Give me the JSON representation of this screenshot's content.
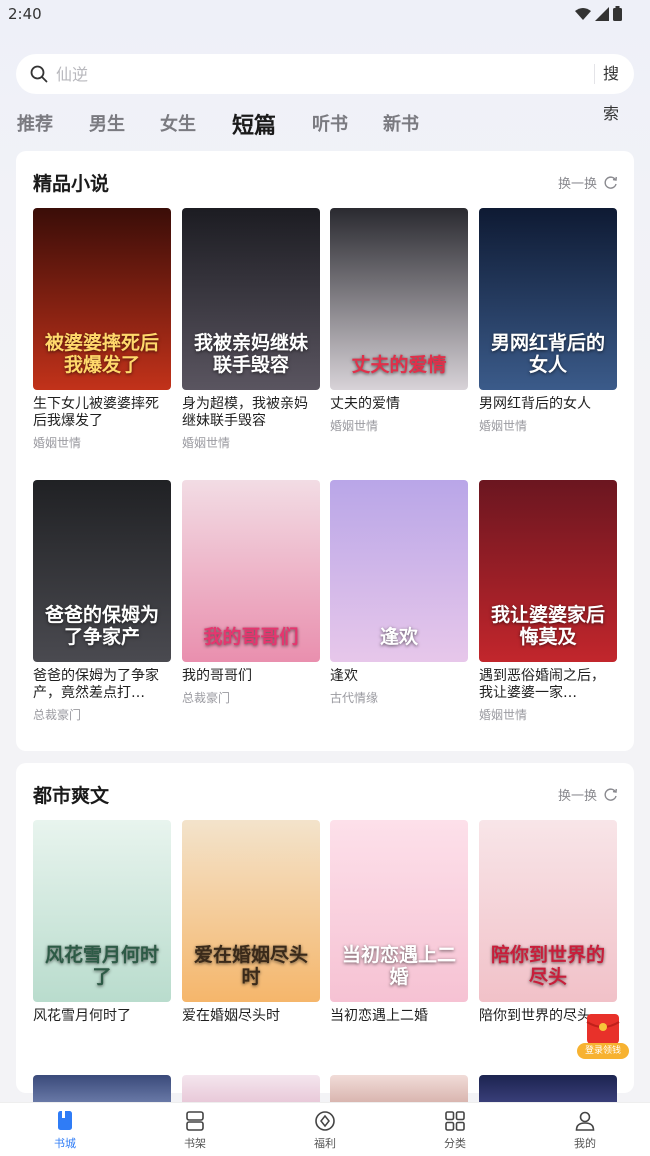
{
  "status_bar": {
    "time": "2:40"
  },
  "search": {
    "placeholder": "仙逆",
    "button_label": "搜索"
  },
  "tabs": [
    {
      "label": "推荐",
      "active": false
    },
    {
      "label": "男生",
      "active": false
    },
    {
      "label": "女生",
      "active": false
    },
    {
      "label": "短篇",
      "active": true
    },
    {
      "label": "听书",
      "active": false
    },
    {
      "label": "新书",
      "active": false
    }
  ],
  "section_premium": {
    "title": "精品小说",
    "refresh_label": "换一换",
    "books": [
      {
        "title": "生下女儿被婆婆摔死后我爆发了",
        "category": "婚姻世情",
        "cover_text": "被婆婆摔死后我爆发了",
        "cover_top": "#3a0d08",
        "cover_bottom": "#c2321a",
        "cover_text_color": "#ffd86b"
      },
      {
        "title": "身为超模，我被亲妈继妹联手毁容",
        "category": "婚姻世情",
        "cover_text": "我被亲妈继妹联手毁容",
        "cover_top": "#1c1c22",
        "cover_bottom": "#5a5560",
        "cover_text_color": "#ffffff"
      },
      {
        "title": "丈夫的爱情",
        "category": "婚姻世情",
        "cover_text": "丈夫的爱情",
        "cover_top": "#2a2a30",
        "cover_bottom": "#d8d3d8",
        "cover_text_color": "#e0304a"
      },
      {
        "title": "男网红背后的女人",
        "category": "婚姻世情",
        "cover_text": "男网红背后的女人",
        "cover_top": "#0e1a33",
        "cover_bottom": "#3b5b8a",
        "cover_text_color": "#ffffff"
      },
      {
        "title": "爸爸的保姆为了争家产，竟然差点打…",
        "category": "总裁豪门",
        "cover_text": "爸爸的保姆为了争家产",
        "cover_top": "#202124",
        "cover_bottom": "#4a4a50",
        "cover_text_color": "#ffffff"
      },
      {
        "title": "我的哥哥们",
        "category": "总裁豪门",
        "cover_text": "我的哥哥们",
        "cover_top": "#f2dce4",
        "cover_bottom": "#e98fae",
        "cover_text_color": "#e5366f"
      },
      {
        "title": "逢欢",
        "category": "古代情缘",
        "cover_text": "逢欢",
        "cover_top": "#b9a6e8",
        "cover_bottom": "#e7c7ea",
        "cover_text_color": "#ffffff"
      },
      {
        "title": "遇到恶俗婚闹之后，我让婆婆一家…",
        "category": "婚姻世情",
        "cover_text": "我让婆婆家后悔莫及",
        "cover_top": "#6b1620",
        "cover_bottom": "#c2262c",
        "cover_text_color": "#ffffff"
      }
    ]
  },
  "section_urban": {
    "title": "都市爽文",
    "refresh_label": "换一换",
    "books": [
      {
        "title": "风花雪月何时了",
        "category": "",
        "cover_text": "风花雪月何时了",
        "cover_top": "#e8f4ee",
        "cover_bottom": "#b9dccd",
        "cover_text_color": "#2d5b46"
      },
      {
        "title": "爱在婚姻尽头时",
        "category": "",
        "cover_text": "爱在婚姻尽头时",
        "cover_top": "#f3e3cb",
        "cover_bottom": "#f5b66b",
        "cover_text_color": "#3a2a1a"
      },
      {
        "title": "当初恋遇上二婚",
        "category": "",
        "cover_text": "当初恋遇上二婚",
        "cover_top": "#fde0ea",
        "cover_bottom": "#f6c2d3",
        "cover_text_color": "#ffffff"
      },
      {
        "title": "陪你到世界的尽头",
        "category": "",
        "cover_text": "陪你到世界的尽头",
        "cover_top": "#f8e5e8",
        "cover_bottom": "#f1c1c8",
        "cover_text_color": "#c81e3a"
      }
    ]
  },
  "float_gift": {
    "label": "登录领钱"
  },
  "bottom_nav": [
    {
      "label": "书城",
      "icon": "book-icon",
      "active": true
    },
    {
      "label": "书架",
      "icon": "shelf-icon",
      "active": false
    },
    {
      "label": "福利",
      "icon": "gift-coin-icon",
      "active": false
    },
    {
      "label": "分类",
      "icon": "grid-icon",
      "active": false
    },
    {
      "label": "我的",
      "icon": "user-icon",
      "active": false
    }
  ],
  "colors": {
    "accent": "#2f7cf6",
    "background": "#f3f3f6",
    "card": "#ffffff"
  }
}
